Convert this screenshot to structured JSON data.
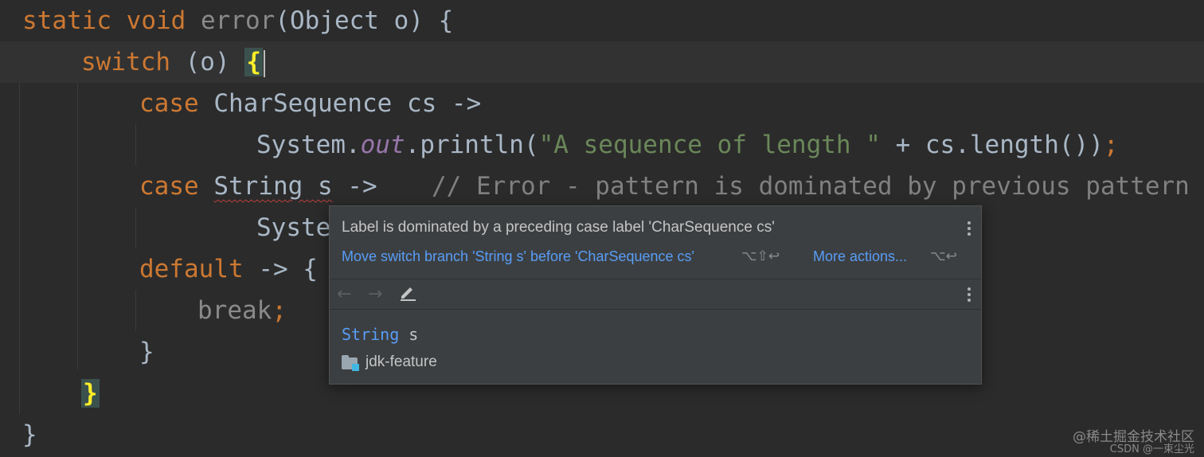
{
  "code": {
    "line1": {
      "kw_static": "static",
      "kw_void": "void",
      "method_name": "error",
      "signature_rest": "(Object o) {"
    },
    "line2": {
      "kw_switch": "switch",
      "paren": " (o) ",
      "open_brace": "{"
    },
    "line3": {
      "kw_case": "case",
      "rest": " CharSequence cs ->"
    },
    "line4": {
      "system": "System.",
      "out": "out",
      "println": ".println(",
      "string": "\"A sequence of length \"",
      "rest": " + cs.length())",
      "semicolon": ";"
    },
    "line5": {
      "kw_case": "case",
      "type": "String",
      "var": " s",
      "arrow": " ->",
      "comment": "// Error - pattern is dominated by previous pattern"
    },
    "line6": {
      "text": "Syste"
    },
    "line7": {
      "kw_default": "default",
      "rest": " -> {"
    },
    "line8": {
      "kw_break": "break",
      "semicolon": ";"
    },
    "line9": {
      "brace": "}"
    },
    "line10": {
      "brace": "}"
    },
    "line11": {
      "brace": "}"
    }
  },
  "popup": {
    "message": "Label is dominated by a preceding case label 'CharSequence cs'",
    "primary_action": "Move switch branch 'String s' before 'CharSequence cs'",
    "primary_shortcut": "⌥⇧↩",
    "more_actions": "More actions...",
    "more_shortcut": "⌥↩",
    "back_icon": "←",
    "forward_icon": "→",
    "type_keyword": "String",
    "type_var": "s",
    "module_name": "jdk-feature"
  },
  "watermark": {
    "line1": "@稀土掘金技术社区",
    "line2": "CSDN @一束尘光"
  },
  "icons": {
    "back": "arrow-left-icon",
    "forward": "arrow-right-icon",
    "edit": "pencil-icon",
    "more": "kebab-menu-icon",
    "module": "module-folder-icon"
  },
  "colors": {
    "background": "#2b2b2b",
    "keyword": "#cc7832",
    "string": "#6a8759",
    "comment": "#808080",
    "static_field": "#9876aa",
    "link": "#589df6",
    "brace_highlight": "#ffef28",
    "error_underline": "#bc3f3c"
  }
}
